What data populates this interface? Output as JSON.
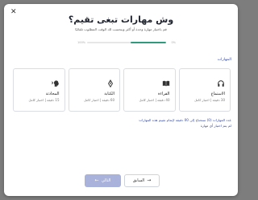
{
  "modal": {
    "close_glyph": "✕",
    "title": "وش مهارات تبغى تقيم؟",
    "subtitle": "قم باختيار مهارة وحدة أو أكثر وبنحسب لك الوقت المطلوب تلقائيًا"
  },
  "progress": {
    "left_label": "100%",
    "right_label": "0%",
    "value_percent": 45,
    "color": "#2f9a7c"
  },
  "skills_section": {
    "label": "المهارات",
    "cards": [
      {
        "name": "الاستماع",
        "meta": "30 دقيقة | اختبار كامل",
        "icon": "headphones-icon"
      },
      {
        "name": "القراءة",
        "meta": "40 دقيقة | اختبار كامل",
        "icon": "book-icon"
      },
      {
        "name": "الكتابة",
        "meta": "60 دقيقة | اختبار كامل",
        "icon": "pen-icon"
      },
      {
        "name": "المحادثة",
        "meta": "15 دقيقة | اختبار كامل",
        "icon": "speaking-head-icon"
      }
    ]
  },
  "notes": {
    "line1": "عدد المهارات (0) ستحتاج إلى 00 دقيقة لإتمام تقييم هذه المهارات",
    "line2": "لم يتم اختيار أي مهارة"
  },
  "footer": {
    "next_label": "التالي",
    "next_arrow": "←",
    "prev_label": "السابق",
    "prev_arrow": "→"
  },
  "colors": {
    "accent": "#3a4da6",
    "next_disabled_bg": "#a8b2da"
  }
}
